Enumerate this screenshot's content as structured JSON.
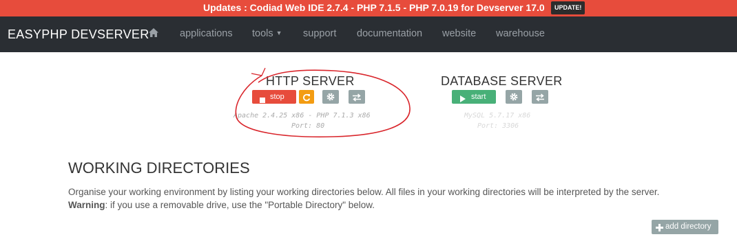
{
  "update_bar": {
    "text": "Updates : Codiad Web IDE 2.7.4 - PHP 7.1.5 - PHP 7.0.19 for Devserver 17.0",
    "button": "UPDATE!"
  },
  "navbar": {
    "brand": "EASYPHP DEVSERVER",
    "items": [
      "applications",
      "tools",
      "support",
      "documentation",
      "website",
      "warehouse"
    ]
  },
  "http_server": {
    "title": "HTTP SERVER",
    "stop_label": "stop",
    "info_line1": "Apache 2.4.25 x86 - PHP 7.1.3 x86",
    "info_line2": "Port: 80"
  },
  "database_server": {
    "title": "DATABASE SERVER",
    "start_label": "start",
    "info_line1": "MySQL 5.7.17 x86",
    "info_line2": "Port: 3306"
  },
  "working_directories": {
    "title": "WORKING DIRECTORIES",
    "description": "Organise your working environment by listing your working directories below. All files in your working directories will be interpreted by the server.",
    "warning_label": "Warning",
    "warning_text": ": if you use a removable drive, use the \"Portable Directory\" below.",
    "add_label": "add directory"
  },
  "colors": {
    "update_bar": "#e74c3c",
    "navbar": "#2a2e33",
    "stop": "#e74c3c",
    "restart": "#f39c12",
    "start": "#48b078",
    "neutral": "#95a5a6",
    "annotation": "#d9252b"
  },
  "icons": [
    "home-icon",
    "caret-down-icon",
    "stop-square-icon",
    "refresh-icon",
    "gear-icon",
    "swap-arrows-icon",
    "play-icon",
    "plus-icon"
  ]
}
